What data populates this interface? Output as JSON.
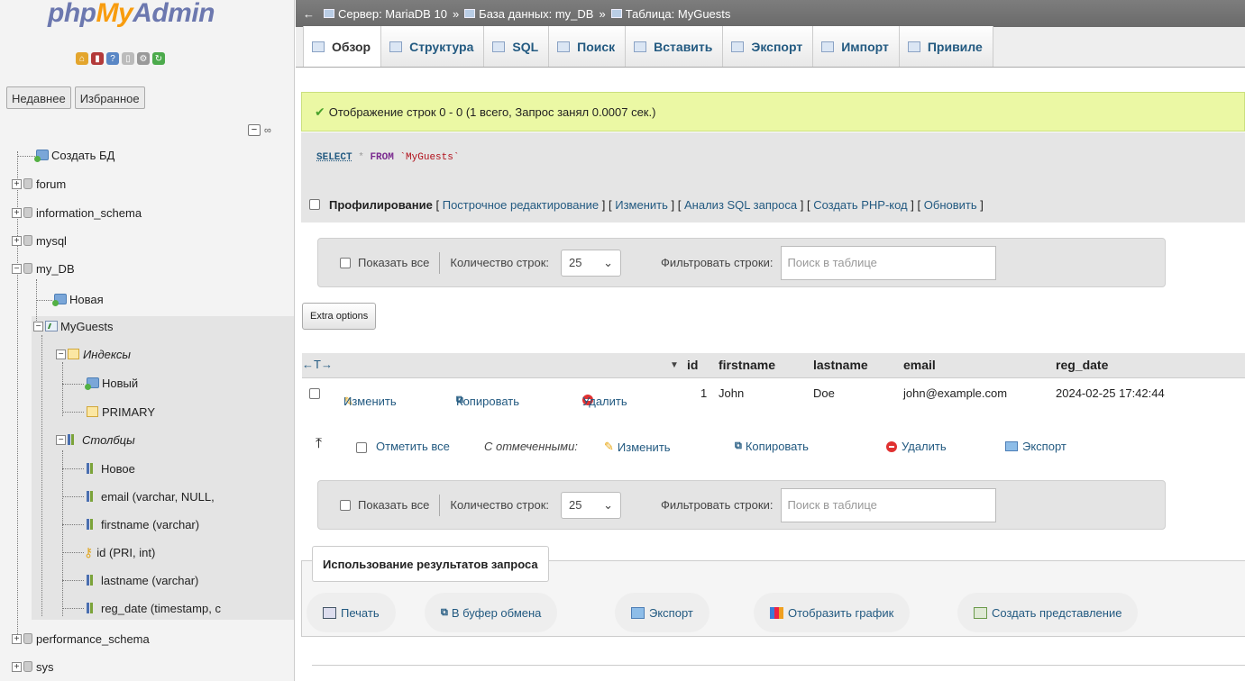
{
  "logo": {
    "php": "php",
    "my": "My",
    "admin": "Admin"
  },
  "sidebar": {
    "tabs": [
      "Недавнее",
      "Избранное"
    ],
    "collapse_minus": "−",
    "link_icon": "∞",
    "tree": {
      "create_db": "Создать БД",
      "dbs": [
        "forum",
        "information_schema",
        "mysql",
        "my_DB",
        "performance_schema",
        "sys"
      ],
      "my_db": {
        "new": "Новая",
        "table": "MyGuests",
        "indexes": "Индексы",
        "new_index": "Новый",
        "primary": "PRIMARY",
        "columns": "Столбцы",
        "new_column": "Новое",
        "column_items": [
          "email (varchar, NULL,",
          "firstname (varchar)",
          "id (PRI, int)",
          "lastname (varchar)",
          "reg_date (timestamp, c"
        ]
      }
    }
  },
  "breadcrumb": {
    "back_arrow": "←",
    "server": "Сервер: MariaDB 10",
    "database": "База данных: my_DB",
    "table": "Таблица: MyGuests",
    "sep": "»"
  },
  "tabs": [
    "Обзор",
    "Структура",
    "SQL",
    "Поиск",
    "Вставить",
    "Экспорт",
    "Импорт",
    "Привиле"
  ],
  "success": {
    "check": "✔",
    "message": "Отображение строк 0 - 0 (1 всего, Запрос занял 0.0007 сек.)"
  },
  "sql": {
    "select": "SELECT",
    "star": "*",
    "from": "FROM",
    "table": "`MyGuests`"
  },
  "profiling": {
    "label": "Профилирование",
    "links": [
      "Построчное редактирование",
      "Изменить",
      "Анализ SQL запроса",
      "Создать PHP-код",
      "Обновить"
    ],
    "open": "[",
    "close": "]"
  },
  "nav": {
    "show_all": "Показать все",
    "rows_label": "Количество строк:",
    "rows_value": "25",
    "filter_label": "Фильтровать строки:",
    "filter_placeholder": "Поиск в таблице"
  },
  "extra_options": "Extra options",
  "table": {
    "sort_arrows": "←T→",
    "sort_icon": "▼",
    "headers": [
      "id",
      "firstname",
      "lastname",
      "email",
      "reg_date"
    ],
    "actions": {
      "edit": "Изменить",
      "copy": "Копировать",
      "delete": "Удалить"
    },
    "rows": [
      {
        "id": "1",
        "firstname": "John",
        "lastname": "Doe",
        "email": "john@example.com",
        "reg_date": "2024-02-25 17:42:44"
      }
    ]
  },
  "with_selected": {
    "check_all": "Отметить все",
    "label": "С отмеченными:",
    "edit": "Изменить",
    "copy": "Копировать",
    "delete": "Удалить",
    "export": "Экспорт"
  },
  "query_results": {
    "legend": "Использование результатов запроса",
    "buttons": [
      "Печать",
      "В буфер обмена",
      "Экспорт",
      "Отобразить график",
      "Создать представление"
    ]
  },
  "colors": {
    "link": "#235a81",
    "success_bg": "#ebf8a4",
    "logo_orange": "#f89c0e",
    "logo_blue": "#6c78af"
  }
}
